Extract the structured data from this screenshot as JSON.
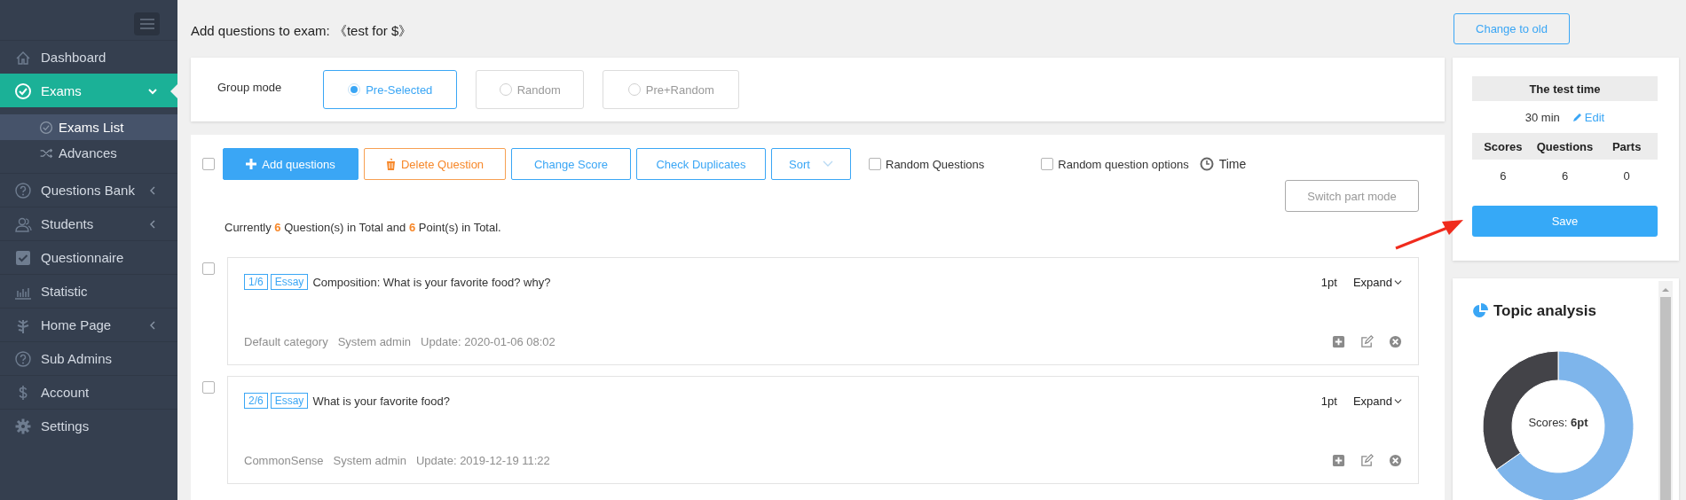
{
  "sidebar": {
    "items": [
      {
        "label": "Dashboard",
        "kind": "link",
        "selected": false
      },
      {
        "label": "Exams",
        "kind": "group",
        "selected": true,
        "expanded": true,
        "children": [
          {
            "label": "Exams List",
            "selected": true
          },
          {
            "label": "Advances",
            "selected": false
          }
        ]
      },
      {
        "label": "Questions Bank",
        "kind": "group",
        "selected": false,
        "expanded": false
      },
      {
        "label": "Students",
        "kind": "group",
        "selected": false,
        "expanded": false
      },
      {
        "label": "Questionnaire",
        "kind": "link",
        "selected": false
      },
      {
        "label": "Statistic",
        "kind": "link",
        "selected": false
      },
      {
        "label": "Home Page",
        "kind": "group",
        "selected": false,
        "expanded": false
      },
      {
        "label": "Sub Admins",
        "kind": "link",
        "selected": false
      },
      {
        "label": "Account",
        "kind": "link",
        "selected": false
      },
      {
        "label": "Settings",
        "kind": "link",
        "selected": false
      }
    ]
  },
  "page_title": "Add questions to exam: 《test for $》",
  "group_mode": {
    "label": "Group mode",
    "options": [
      {
        "label": "Pre-Selected",
        "selected": true
      },
      {
        "label": "Random",
        "selected": false
      },
      {
        "label": "Pre+Random",
        "selected": false
      }
    ]
  },
  "toolbar": {
    "select_all": {
      "checked": false
    },
    "buttons": [
      {
        "label": "Add questions",
        "kind": "primary"
      },
      {
        "label": "Delete Question",
        "kind": "danger"
      },
      {
        "label": "Change Score",
        "kind": "outline"
      },
      {
        "label": "Check Duplicates",
        "kind": "outline"
      },
      {
        "label": "Sort",
        "kind": "dropdown"
      }
    ],
    "options": [
      {
        "label": "Random Questions",
        "checked": false
      },
      {
        "label": "Random question options",
        "checked": false
      }
    ],
    "time": "Time",
    "switch_button": "Switch part mode"
  },
  "summary": {
    "prefix": "Currently",
    "question_count": "6",
    "middle": "Question(s) in Total and",
    "point_count": "6",
    "suffix": "Point(s) in Total."
  },
  "questions": [
    {
      "checked": false,
      "number": "1/6",
      "type": "Essay",
      "title": "Composition: What is your favorite food? why?",
      "score": "1pt",
      "expand": "Expand",
      "category": "Default category",
      "author": "System admin",
      "updated": "Update: 2020-01-06 08:02"
    },
    {
      "checked": false,
      "number": "2/6",
      "type": "Essay",
      "title": "What is your favorite food?",
      "score": "1pt",
      "expand": "Expand",
      "category": "CommonSense",
      "author": "System admin",
      "updated": "Update: 2019-12-19 11:22"
    }
  ],
  "side_panel": {
    "change_button": "Change to old",
    "time_heading": "The test time",
    "time_value": "30 min",
    "edit_link": "Edit",
    "stats": {
      "columns": [
        "Scores",
        "Questions",
        "Parts"
      ],
      "values": [
        "6",
        "6",
        "0"
      ]
    },
    "save_button": "Save"
  },
  "topic_analysis": {
    "title": "Topic analysis",
    "center_label": "Scores: **6pt**"
  }
}
